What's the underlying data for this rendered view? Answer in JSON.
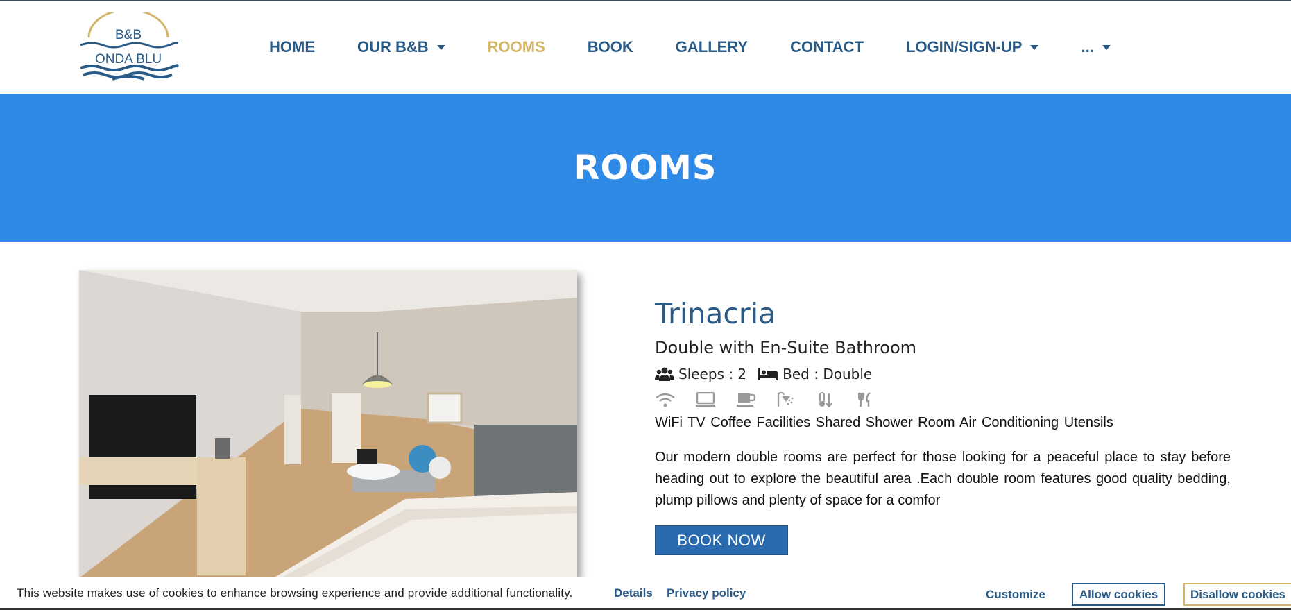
{
  "nav": {
    "items": [
      {
        "label": "HOME",
        "dropdown": false,
        "active": false
      },
      {
        "label": "OUR B&B",
        "dropdown": true,
        "active": false
      },
      {
        "label": "ROOMS",
        "dropdown": false,
        "active": true
      },
      {
        "label": "BOOK",
        "dropdown": false,
        "active": false
      },
      {
        "label": "GALLERY",
        "dropdown": false,
        "active": false
      },
      {
        "label": "CONTACT",
        "dropdown": false,
        "active": false
      },
      {
        "label": "LOGIN/SIGN-UP",
        "dropdown": true,
        "active": false
      },
      {
        "label": "...",
        "dropdown": true,
        "active": false
      }
    ]
  },
  "logo": {
    "top_text": "B&B",
    "bottom_text": "ONDA BLU"
  },
  "hero": {
    "title": "ROOMS"
  },
  "room": {
    "name": "Trinacria",
    "type": "Double with En-Suite Bathroom",
    "sleeps": "Sleeps : 2",
    "bed": "Bed : Double",
    "amenity_icons": [
      "wifi-icon",
      "tv-icon",
      "coffee-icon",
      "shower-icon",
      "thermometer-icon",
      "utensils-icon"
    ],
    "amenities_text": "WiFi TV Coffee Facilities Shared Shower Room Air Conditioning Utensils",
    "description": "Our modern double rooms are perfect for those looking for a peaceful place to stay before heading out to explore the beautiful area .Each double room features good quality bedding, plump pillows and plenty of space for a comfor",
    "book_label": "BOOK NOW"
  },
  "cookie": {
    "message": "This website makes use of cookies to enhance browsing experience and provide additional functionality.",
    "details": "Details",
    "privacy": "Privacy policy",
    "customize": "Customize",
    "allow": "Allow cookies",
    "disallow": "Disallow cookies"
  },
  "colors": {
    "nav_text": "#2a5a86",
    "nav_active": "#d3b56a",
    "hero_bg": "#2e8ae6",
    "button_bg": "#2a6bb0"
  }
}
